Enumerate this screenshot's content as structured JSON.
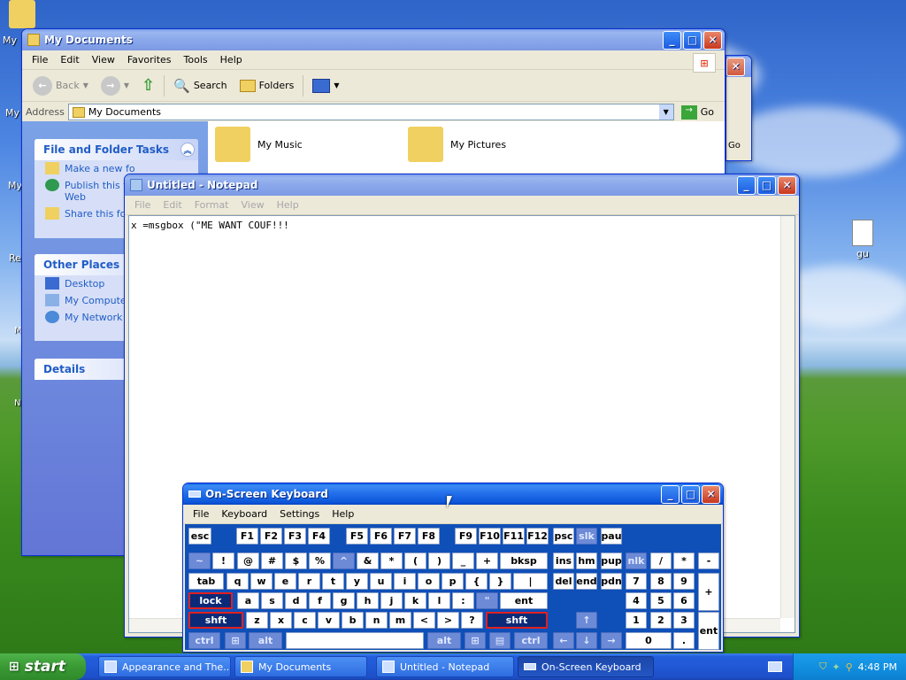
{
  "desktop": {
    "icons": [
      {
        "label": "My",
        "name": "desktop-icon-my-documents"
      },
      {
        "label": "My",
        "name": "desktop-icon-my-computer"
      },
      {
        "label": "My",
        "name": "desktop-icon-my-network"
      },
      {
        "label": "Re",
        "name": "desktop-icon-recycle"
      },
      {
        "label": "M",
        "name": "desktop-icon-m"
      },
      {
        "label": "N",
        "name": "desktop-icon-n"
      },
      {
        "label": "gu",
        "name": "desktop-icon-gu"
      }
    ]
  },
  "explorer": {
    "title": "My Documents",
    "menu": [
      "File",
      "Edit",
      "View",
      "Favorites",
      "Tools",
      "Help"
    ],
    "toolbar": {
      "back": "Back",
      "search": "Search",
      "folders": "Folders"
    },
    "address": {
      "label": "Address",
      "value": "My Documents",
      "go": "Go"
    },
    "tasks": {
      "header": "File and Folder Tasks",
      "items": [
        "Make a new fo",
        "Publish this fo",
        "Web",
        "Share this fol"
      ]
    },
    "places": {
      "header": "Other Places",
      "items": [
        "Desktop",
        "My Computer",
        "My Network P"
      ]
    },
    "details": {
      "header": "Details"
    },
    "folders": [
      "My Music",
      "My Pictures"
    ]
  },
  "back_window": {
    "go": "Go"
  },
  "notepad": {
    "title": "Untitled - Notepad",
    "menu": [
      "File",
      "Edit",
      "Format",
      "View",
      "Help"
    ],
    "text": "x =msgbox (\"ME WANT COUF!!!"
  },
  "osk": {
    "title": "On-Screen Keyboard",
    "menu": [
      "File",
      "Keyboard",
      "Settings",
      "Help"
    ],
    "rows": {
      "fn": [
        "esc",
        "F1",
        "F2",
        "F3",
        "F4",
        "F5",
        "F6",
        "F7",
        "F8",
        "F9",
        "F10",
        "F11",
        "F12",
        "psc",
        "slk",
        "pau"
      ],
      "num": [
        "~",
        "!",
        "@",
        "#",
        "$",
        "%",
        "^",
        "&",
        "*",
        "(",
        ")",
        "_",
        "+",
        "bksp",
        "ins",
        "hm",
        "pup",
        "nlk",
        "/",
        "*",
        "-"
      ],
      "tab": [
        "tab",
        "q",
        "w",
        "e",
        "r",
        "t",
        "y",
        "u",
        "i",
        "o",
        "p",
        "{",
        "}",
        "|",
        "del",
        "end",
        "pdn",
        "7",
        "8",
        "9",
        "+"
      ],
      "caps": [
        "lock",
        "a",
        "s",
        "d",
        "f",
        "g",
        "h",
        "j",
        "k",
        "l",
        ":",
        "\"",
        "ent",
        "4",
        "5",
        "6"
      ],
      "shift": [
        "shft",
        "z",
        "x",
        "c",
        "v",
        "b",
        "n",
        "m",
        "<",
        ">",
        "?",
        "shft",
        "↑",
        "1",
        "2",
        "3",
        "ent"
      ],
      "bottom": [
        "ctrl",
        "alt",
        "alt",
        "ctrl",
        "←",
        "↓",
        "→",
        "0",
        "."
      ]
    }
  },
  "taskbar": {
    "start": "start",
    "items": [
      "Appearance and The...",
      "My Documents",
      "Untitled - Notepad",
      "On-Screen Keyboard"
    ],
    "clock": "4:48 PM"
  },
  "colors": {
    "title_active": "#0a5fe6",
    "keyboard_bg": "#0f4fb8",
    "lock_border": "#e02020",
    "task_link": "#215dc6"
  }
}
